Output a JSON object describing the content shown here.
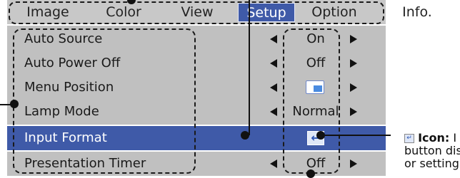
{
  "tabs": [
    {
      "label": "Image"
    },
    {
      "label": "Color"
    },
    {
      "label": "View"
    },
    {
      "label": "Setup"
    },
    {
      "label": "Option"
    },
    {
      "label": "Info."
    }
  ],
  "rows": [
    {
      "label": "Auto Source",
      "value": "On"
    },
    {
      "label": "Auto Power Off",
      "value": "Off"
    },
    {
      "label": "Menu Position",
      "value": "",
      "icon": "menu-position-icon"
    },
    {
      "label": "Lamp Mode",
      "value": "Normal"
    },
    {
      "label": "Input Format",
      "value": "",
      "icon": "enter-icon"
    },
    {
      "label": "Presentation Timer",
      "value": "Off"
    }
  ],
  "annotation": {
    "icon_glyph": "↵",
    "title": "Icon:",
    "line1_tail": " I",
    "line2": "button dis",
    "line3": "or setting"
  },
  "colors": {
    "menu_bg": "#c0c0c0",
    "highlight": "#3f5aa8",
    "text": "#1a1a1a"
  }
}
